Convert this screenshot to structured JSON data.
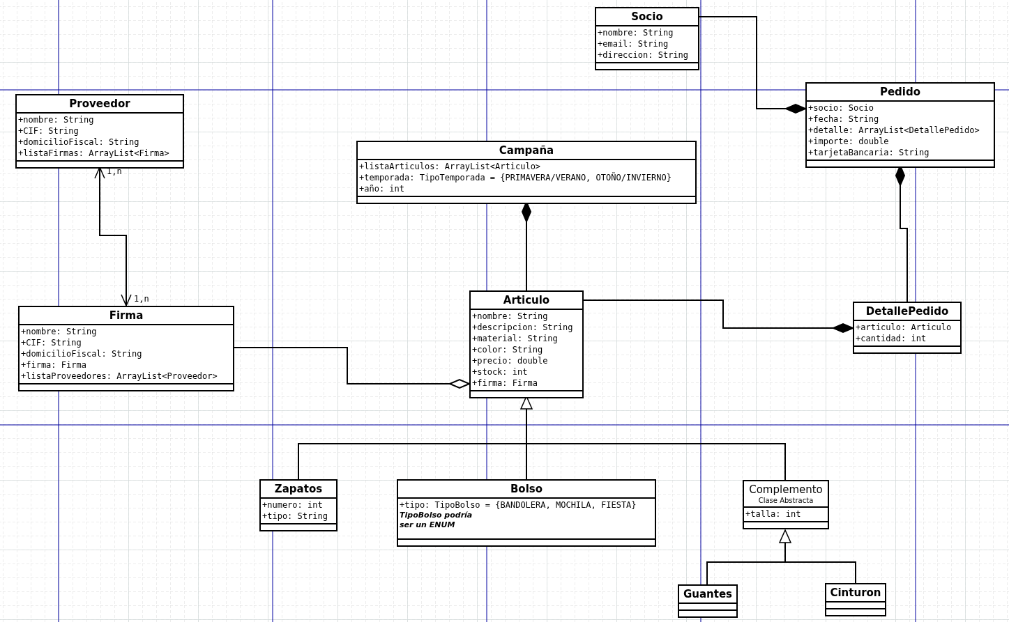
{
  "classes": [
    {
      "name": "Socio",
      "attributes": [
        "+nombre: String",
        "+email: String",
        "+direccion: String"
      ]
    },
    {
      "name": "Proveedor",
      "attributes": [
        "+nombre: String",
        "+CIF: String",
        "+domicilioFiscal: String",
        "+listaFirmas: ArrayList<Firma>"
      ]
    },
    {
      "name": "Pedido",
      "attributes": [
        "+socio: Socio",
        "+fecha: String",
        "+detalle: ArrayList<DetallePedido>",
        "+importe: double",
        "+tarjetaBancaria: String"
      ]
    },
    {
      "name": "Campaña",
      "attributes": [
        "+listaArticulos: ArrayList<Articulo>",
        "+temporada: TipoTemporada = {PRIMAVERA/VERANO, OTOÑO/INVIERNO}",
        "+año: int"
      ]
    },
    {
      "name": "Firma",
      "attributes": [
        "+nombre: String",
        "+CIF: String",
        "+domicilioFiscal: String",
        "+firma: Firma",
        "+listaProveedores: ArrayList<Proveedor>"
      ]
    },
    {
      "name": "Articulo",
      "attributes": [
        "+nombre: String",
        "+descripcion: String",
        "+material: String",
        "+color: String",
        "+precio: double",
        "+stock: int",
        "+firma: Firma"
      ]
    },
    {
      "name": "DetallePedido",
      "attributes": [
        "+articulo: Articulo",
        "+cantidad: int"
      ]
    },
    {
      "name": "Zapatos",
      "attributes": [
        "+numero: int",
        "+tipo: String"
      ]
    },
    {
      "name": "Bolso",
      "attributes": [
        "+tipo: TipoBolso = {BANDOLERA, MOCHILA, FIESTA}"
      ],
      "note": "TipoBolso podría\nser un ENUM"
    },
    {
      "name": "Complemento",
      "subtitle": "Clase Abstracta",
      "attributes": [
        "+talla: int"
      ]
    },
    {
      "name": "Guantes"
    },
    {
      "name": "Cinturon"
    }
  ],
  "relations": [
    {
      "kind": "composition"
    },
    {
      "kind": "association",
      "labels": [
        "1,n",
        "1,n"
      ]
    },
    {
      "kind": "composition"
    },
    {
      "kind": "composition"
    },
    {
      "kind": "composition"
    },
    {
      "kind": "aggregation"
    },
    {
      "kind": "generalization"
    },
    {
      "kind": "generalization"
    }
  ]
}
